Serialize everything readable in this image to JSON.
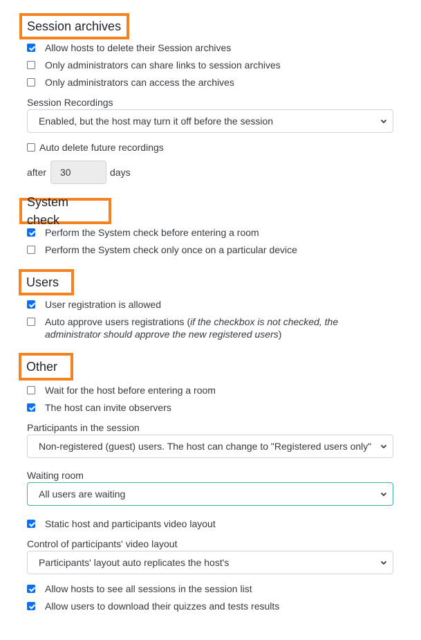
{
  "sections": {
    "session_archives": {
      "title": "Session archives",
      "checkboxes": [
        {
          "label": "Allow hosts to delete their Session archives",
          "checked": true
        },
        {
          "label": "Only administrators can share links to session archives",
          "checked": false
        },
        {
          "label": "Only administrators can access the archives",
          "checked": false
        }
      ],
      "recordings_label": "Session Recordings",
      "recordings_value": "Enabled, but the host may turn it off before the session",
      "auto_delete": {
        "label": "Auto delete future recordings",
        "checked": false
      },
      "after_label": "after",
      "days_value": "30",
      "days_label": "days"
    },
    "system_check": {
      "title": "System check",
      "checkboxes": [
        {
          "label": "Perform the System check before entering a room",
          "checked": true
        },
        {
          "label": "Perform the System check only once on a particular device",
          "checked": false
        }
      ]
    },
    "users": {
      "title": "Users",
      "checkboxes": [
        {
          "label": "User registration is allowed",
          "checked": true
        },
        {
          "label": "Auto approve users registrations (",
          "note": "if the checkbox is not checked, the administrator should approve the new registered users",
          "suffix": ")",
          "checked": false
        }
      ]
    },
    "other": {
      "title": "Other",
      "checkboxes": [
        {
          "label": "Wait for the host before entering a room",
          "checked": false
        },
        {
          "label": "The host can invite observers",
          "checked": true
        }
      ],
      "participants_label": "Participants in the session",
      "participants_value": "Non-registered (guest) users. The host can change to \"Registered users only\" b",
      "waiting_label": "Waiting room",
      "waiting_value": "All users are waiting",
      "static_layout": {
        "label": "Static host and participants video layout",
        "checked": true
      },
      "control_label": "Control of participants' video layout",
      "control_value": "Participants' layout auto replicates the host's",
      "bottom_checkboxes": [
        {
          "label": "Allow hosts to see all sessions in the session list",
          "checked": true
        },
        {
          "label": "Allow users to download their quizzes and tests results",
          "checked": true
        }
      ]
    }
  },
  "colors": {
    "highlight_border": "#f5821f",
    "checkbox_checked": "#0b6ff4",
    "focus_border": "#3fb39a"
  }
}
